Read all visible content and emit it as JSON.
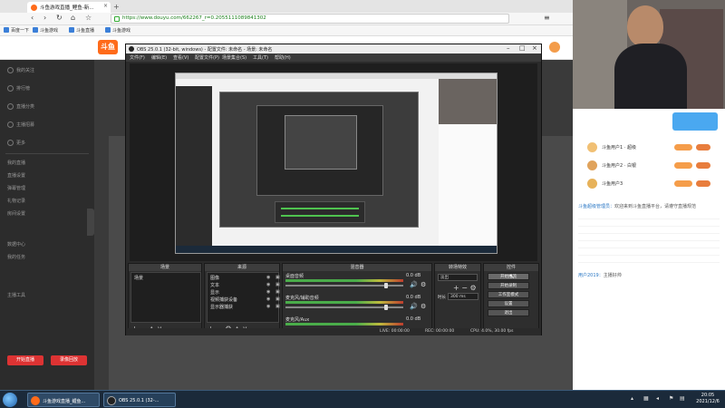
{
  "browser": {
    "tab_title": "斗鱼游戏直播_鲤鱼-新...",
    "url": "https://www.douyu.com/662267_r=0.2055111089841302",
    "bookmarks": [
      "百度一下",
      "斗鱼游戏",
      "斗鱼直播",
      "斗鱼游戏"
    ]
  },
  "douyu": {
    "logo": "斗鱼",
    "sidebar_items": [
      "我的关注",
      "排行榜",
      "直播分类",
      "主播招募",
      "更多",
      "我的直播",
      "直播设置",
      "弹幕管理",
      "礼物记录",
      "房间设置",
      "数据中心",
      "我的任务",
      "主播工具"
    ],
    "live_button": "开始直播",
    "record_button": "录像回放",
    "chat": [
      {
        "name": "斗鱼超级管理员：",
        "text": "欢迎来到斗鱼直播平台，请遵守直播规范"
      },
      {
        "name": "用户2019：",
        "text": "主播好帅"
      }
    ],
    "ranks": [
      {
        "name": "斗鱼用户1 · 超级"
      },
      {
        "name": "斗鱼用户2 · 白银"
      },
      {
        "name": "斗鱼用户3"
      }
    ]
  },
  "obs": {
    "title": "OBS 25.0.1 (32-bit, windows) - 配置文件: 未命名 - 场景: 未命名",
    "menu": [
      "文件(F)",
      "编辑(E)",
      "查看(V)",
      "配置文件(P)",
      "场景集合(S)",
      "工具(T)",
      "帮助(H)"
    ],
    "docks": {
      "scenes": "场景",
      "sources": "来源",
      "mixer": "混音器",
      "transitions": "转场特效",
      "controls": "控件"
    },
    "scene_items": [
      "场景"
    ],
    "source_items": [
      "图像",
      "文本",
      "显示",
      "视频捕获设备",
      "显示器捕获"
    ],
    "mixer": [
      {
        "label": "桌面音频",
        "db": "0.0 dB"
      },
      {
        "label": "麦克风/辅助音频",
        "db": "0.0 dB"
      },
      {
        "label": "麦克风/Aux",
        "db": "0.0 dB"
      }
    ],
    "transition": {
      "type": "淡出",
      "duration_label": "时长",
      "duration": "300 ms"
    },
    "controls": [
      "开始推流",
      "开始录制",
      "工作室模式",
      "设置",
      "退出"
    ],
    "status": {
      "live": "LIVE: 00:00:00",
      "rec": "REC: 00:00:00",
      "cpu": "CPU: 4.0%, 30.00 fps"
    }
  },
  "taskbar": {
    "items": [
      "斗鱼游戏直播_鲤鱼...",
      "OBS 25.0.1 (32-..."
    ],
    "time": "20:05",
    "date": "2021/12/6"
  },
  "colors": {
    "accent": "#ff6b1a",
    "obs_bg": "#2b2b2b",
    "taskbar": "#1b2a3a"
  }
}
